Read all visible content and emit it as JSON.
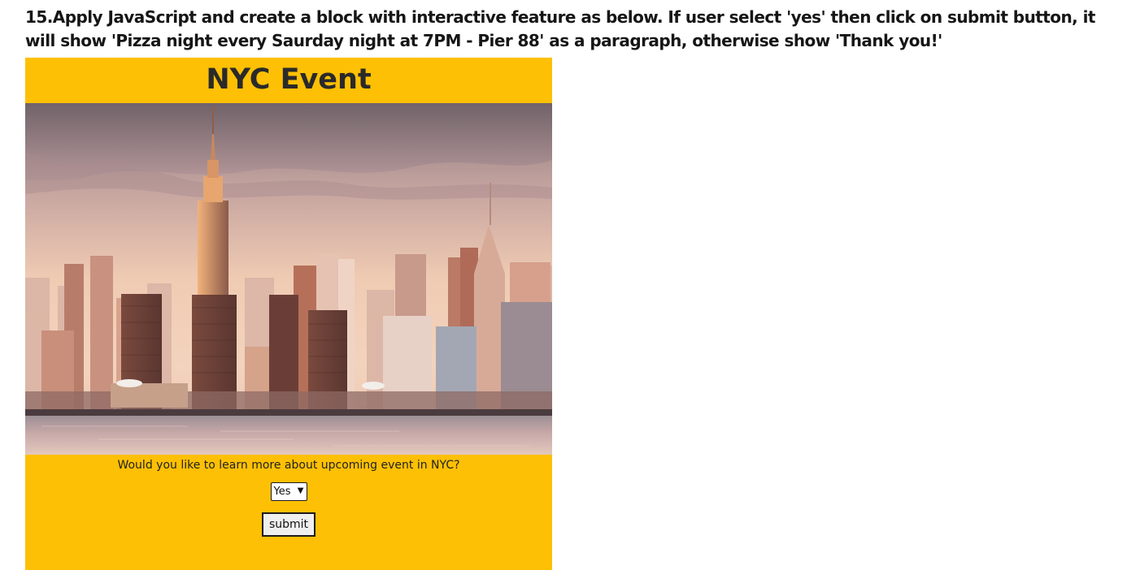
{
  "instructions": "15.Apply JavaScript and create a block with interactive feature as below. If user select 'yes' then click on submit button, it will show 'Pizza night every Saurday night at 7PM - Pier 88' as a paragraph, otherwise show 'Thank you!'",
  "event": {
    "title": "NYC Event",
    "prompt": "Would you like to learn more about upcoming event in NYC?",
    "select_value": "Yes",
    "submit_label": "submit"
  },
  "colors": {
    "card_background": "#fec004",
    "sky": "#e6b9a3",
    "water": "#c9a9a6"
  }
}
